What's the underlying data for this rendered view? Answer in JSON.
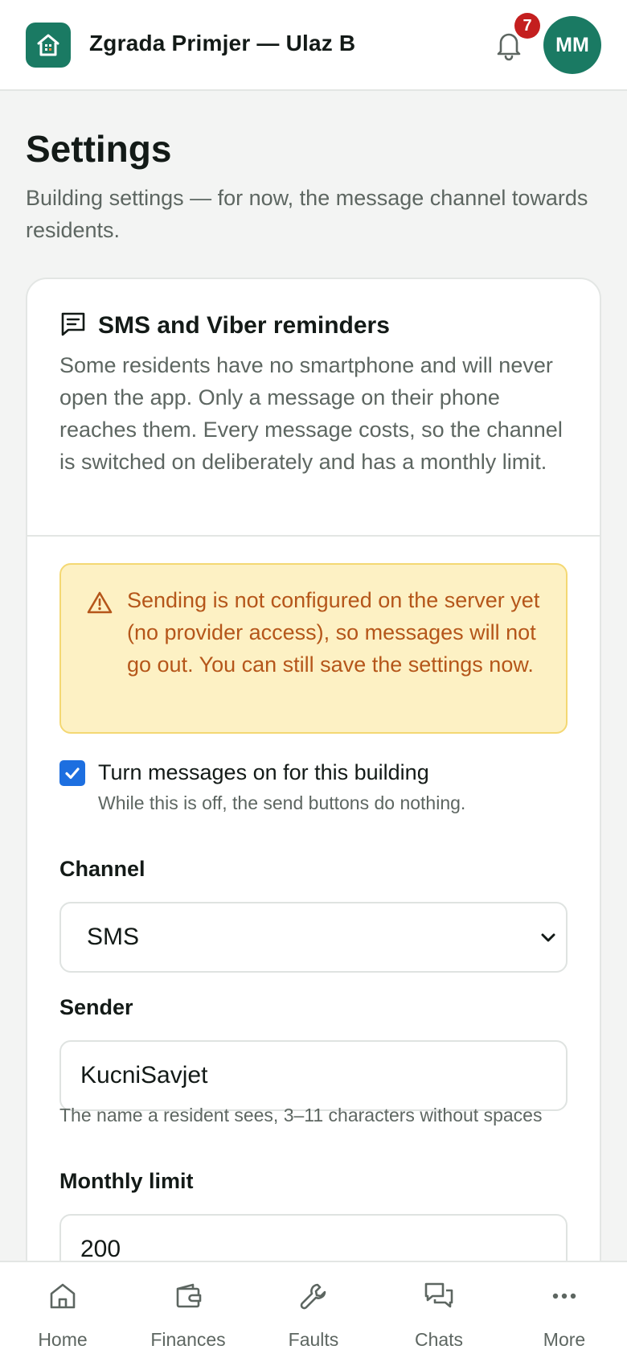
{
  "header": {
    "building_name": "Zgrada Primjer — Ulaz B",
    "notification_count": "7",
    "avatar_initials": "MM",
    "icons": {
      "logo": "house-icon",
      "bell": "bell-icon"
    }
  },
  "page": {
    "title": "Settings",
    "subtitle": "Building settings — for now, the message channel towards residents."
  },
  "card": {
    "title": "SMS and Viber reminders",
    "description": "Some residents have no smartphone and will never open the app. Only a message on their phone reaches them. Every message costs, so the channel is switched on deliberately and has a monthly limit.",
    "warning": "Sending is not configured on the server yet (no provider access), so messages will not go out. You can still save the settings now.",
    "enable": {
      "checked": true,
      "label": "Turn messages on for this building",
      "help": "While this is off, the send buttons do nothing."
    },
    "channel": {
      "label": "Channel",
      "value": "SMS"
    },
    "sender": {
      "label": "Sender",
      "value": "KucniSavjet",
      "help": "The name a resident sees, 3–11 characters without spaces"
    },
    "monthly_limit": {
      "label": "Monthly limit",
      "value": "200"
    }
  },
  "nav": {
    "items": [
      {
        "label": "Home",
        "icon": "home-icon"
      },
      {
        "label": "Finances",
        "icon": "wallet-icon"
      },
      {
        "label": "Faults",
        "icon": "wrench-icon"
      },
      {
        "label": "Chats",
        "icon": "chat-icon"
      },
      {
        "label": "More",
        "icon": "more-icon"
      }
    ]
  },
  "colors": {
    "brand": "#1a7a63",
    "badge": "#c41f1f",
    "warning_bg": "#fdf1c4",
    "warning_text": "#b5561a",
    "checkbox": "#1d6fe0"
  }
}
